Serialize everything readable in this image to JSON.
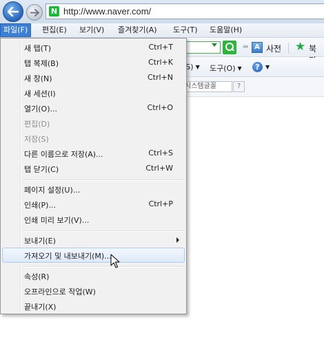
{
  "address_bar": {
    "url": "http://www.naver.com/",
    "site_icon_letter": "N",
    "back_icon": "back-arrow-icon",
    "forward_icon": "forward-arrow-icon"
  },
  "menubar": {
    "items": [
      {
        "label": "파일(F)",
        "active": true
      },
      {
        "label": "편집(E)"
      },
      {
        "label": "보기(V)"
      },
      {
        "label": "즐겨찾기(A)"
      },
      {
        "label": "도구(T)"
      },
      {
        "label": "도움말(H)"
      }
    ]
  },
  "toolbar": {
    "dictionary_label": "사전",
    "bookmark_label": "북마",
    "page_menu_partial": "(S)",
    "tools_menu_label": "도구(O)",
    "font_field_text": "시스템글꼴",
    "font_help": "?"
  },
  "file_menu": {
    "items": [
      {
        "label": "새 탭(T)",
        "shortcut": "Ctrl+T"
      },
      {
        "label": "탭 복제(B)",
        "shortcut": "Ctrl+K"
      },
      {
        "label": "새 창(N)",
        "shortcut": "Ctrl+N"
      },
      {
        "label": "새 세션(I)",
        "shortcut": ""
      },
      {
        "label": "열기(O)...",
        "shortcut": "Ctrl+O"
      },
      {
        "label": "편집(D)",
        "shortcut": "",
        "disabled": true
      },
      {
        "label": "저장(S)",
        "shortcut": "",
        "disabled": true
      },
      {
        "label": "다른 이름으로 저장(A)...",
        "shortcut": "Ctrl+S"
      },
      {
        "label": "탭 닫기(C)",
        "shortcut": "Ctrl+W"
      },
      {
        "label": "페이지 설정(U)...",
        "shortcut": ""
      },
      {
        "label": "인쇄(P)...",
        "shortcut": "Ctrl+P"
      },
      {
        "label": "인쇄 미리 보기(V)...",
        "shortcut": ""
      },
      {
        "label": "보내기(E)",
        "shortcut": "",
        "submenu": true
      },
      {
        "label": "가져오기 및 내보내기(M)...",
        "shortcut": "",
        "hover": true
      },
      {
        "label": "속성(R)",
        "shortcut": ""
      },
      {
        "label": "오프라인으로 작업(W)",
        "shortcut": ""
      },
      {
        "label": "끝내기(X)",
        "shortcut": ""
      }
    ]
  },
  "colors": {
    "menubar_active": "#3c7fd4",
    "menu_background": "#f1f1f1",
    "hover_border": "#aecbee",
    "search_green": "#2db53c"
  }
}
